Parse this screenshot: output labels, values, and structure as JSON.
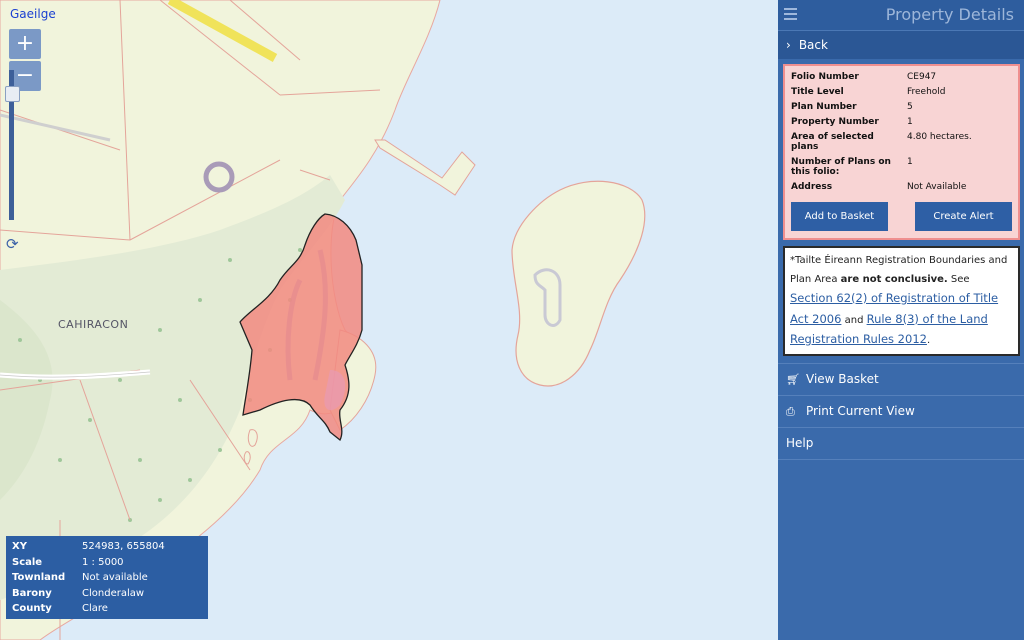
{
  "map": {
    "language_link": "Gaeilge",
    "zoom_in": "+",
    "zoom_out": "−",
    "reset_icon": "refresh-icon",
    "place_label": "CAHIRACON",
    "colors": {
      "sea": "#dcebf8",
      "land": "#f1f4dc",
      "forest": "#e4ecd6",
      "parcel": "#f28a80",
      "road": "#f0e060"
    }
  },
  "info": {
    "rows": [
      {
        "label": "XY",
        "value": "524983, 655804"
      },
      {
        "label": "Scale",
        "value": "1 : 5000"
      },
      {
        "label": "Townland",
        "value": "Not available"
      },
      {
        "label": "Barony",
        "value": "Clonderalaw"
      },
      {
        "label": "County",
        "value": "Clare"
      }
    ]
  },
  "panel": {
    "title": "Property Details",
    "back_label": "Back",
    "properties": [
      {
        "label": "Folio Number",
        "value": "CE947"
      },
      {
        "label": "Title Level",
        "value": "Freehold"
      },
      {
        "label": "Plan Number",
        "value": "5"
      },
      {
        "label": "Property Number",
        "value": "1"
      },
      {
        "label": "Area of selected plans",
        "value": "4.80 hectares."
      },
      {
        "label": "Number of Plans on this folio:",
        "value": "1"
      },
      {
        "label": "Address",
        "value": "Not Available"
      }
    ],
    "add_to_basket": "Add to Basket",
    "create_alert": "Create Alert",
    "note": {
      "text1": "*Tailte Éireann Registration Boundaries and Plan Area ",
      "bold": "are not conclusive.",
      "text2": " See ",
      "link1": "Section 62(2) of Registration of Title Act 2006",
      "text3": " and ",
      "link2": "Rule 8(3) of the Land Registration Rules 2012",
      "text4": "."
    },
    "view_basket": "View Basket",
    "print_view": "Print Current View",
    "help": "Help"
  }
}
